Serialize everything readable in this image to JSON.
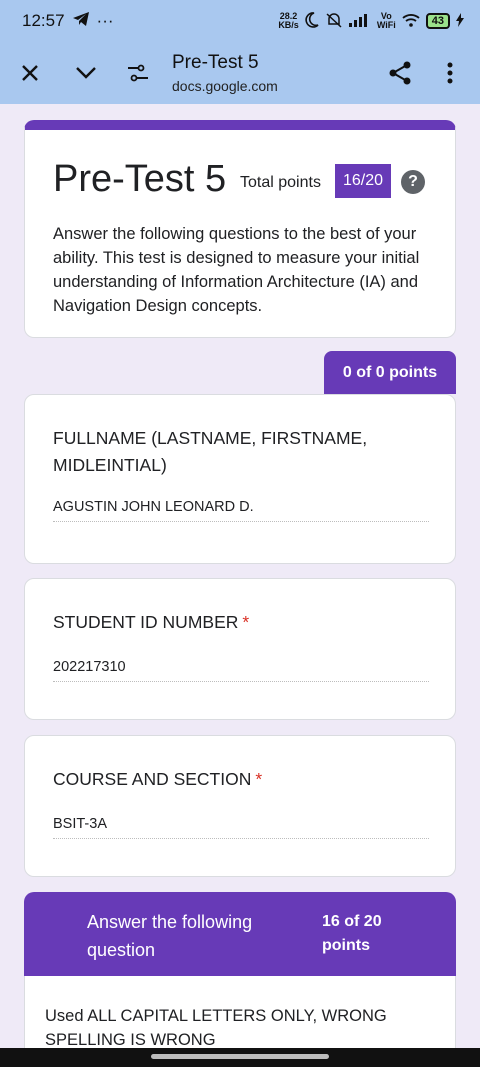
{
  "status_bar": {
    "time": "12:57",
    "net_speed_value": "28.2",
    "net_speed_unit": "KB/s",
    "vo_wifi_line1": "Vo",
    "vo_wifi_line2": "WiFi",
    "battery": "43",
    "more": "···"
  },
  "browser": {
    "page_title": "Pre-Test 5",
    "url": "docs.google.com"
  },
  "form": {
    "title": "Pre-Test 5",
    "total_points_label": "Total points",
    "score": "16/20",
    "help_glyph": "?",
    "description": "Answer the following questions to the best of your ability. This test is designed to measure your initial understanding of Information Architecture (IA) and Navigation Design concepts."
  },
  "points_tab": "0 of 0 points",
  "questions": [
    {
      "label": "FULLNAME (LASTNAME, FIRSTNAME, MIDLEINTIAL)",
      "required": "",
      "answer": "AGUSTIN JOHN LEONARD D."
    },
    {
      "label": "STUDENT ID NUMBER",
      "required": "*",
      "answer": "202217310"
    },
    {
      "label": "COURSE AND SECTION",
      "required": "*",
      "answer": "BSIT-3A"
    }
  ],
  "section": {
    "title": "Answer the following question",
    "points": "16 of 20 points",
    "description": "Used ALL CAPITAL LETTERS ONLY, WRONG SPELLING IS WRONG"
  },
  "colors": {
    "accent": "#673ab7",
    "toolbar": "#a9c8ef",
    "background": "#efeaf7",
    "required": "#d93025"
  },
  "icons": [
    "telegram-icon",
    "moon-icon",
    "mute-icon",
    "signal-icon",
    "wifi-icon",
    "battery-icon",
    "charging-icon",
    "close-icon",
    "chevron-down-icon",
    "tune-icon",
    "share-icon",
    "more-vert-icon",
    "help-icon"
  ]
}
